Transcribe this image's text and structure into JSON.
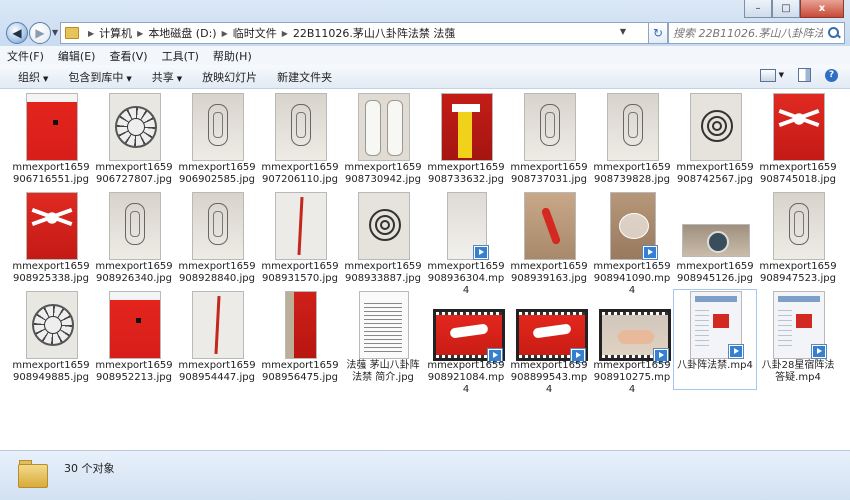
{
  "window": {
    "caption_buttons": [
      "–",
      "□",
      "x"
    ],
    "breadcrumb": [
      "计算机",
      "本地磁盘 (D:)",
      "临时文件",
      "22B11026.茅山八卦阵法禁  法蔃"
    ],
    "search_placeholder": "搜索 22B11026.茅山八卦阵法禁  法蔃"
  },
  "menu": [
    "文件(F)",
    "编辑(E)",
    "查看(V)",
    "工具(T)",
    "帮助(H)"
  ],
  "toolbar": {
    "organize": "组织",
    "include_library": "包含到库中",
    "share": "共享",
    "slideshow": "放映幻灯片",
    "new_folder": "新建文件夹"
  },
  "files": [
    {
      "name": "mmexport1659906716551.jpg",
      "kind": "red"
    },
    {
      "name": "mmexport1659906727807.jpg",
      "kind": "wheel"
    },
    {
      "name": "mmexport1659906902585.jpg",
      "kind": "sketch"
    },
    {
      "name": "mmexport1659907206110.jpg",
      "kind": "sketch"
    },
    {
      "name": "mmexport1659908730942.jpg",
      "kind": "figures"
    },
    {
      "name": "mmexport1659908733632.jpg",
      "kind": "yellow"
    },
    {
      "name": "mmexport1659908737031.jpg",
      "kind": "sketch"
    },
    {
      "name": "mmexport1659908739828.jpg",
      "kind": "sketch"
    },
    {
      "name": "mmexport1659908742567.jpg",
      "kind": "spiral"
    },
    {
      "name": "mmexport1659908745018.jpg",
      "kind": "redfig"
    },
    {
      "name": "mmexport1659908925338.jpg",
      "kind": "redfig"
    },
    {
      "name": "mmexport1659908926340.jpg",
      "kind": "sketch"
    },
    {
      "name": "mmexport1659908928840.jpg",
      "kind": "sketch"
    },
    {
      "name": "mmexport1659908931570.jpg",
      "kind": "stick"
    },
    {
      "name": "mmexport1659908933887.jpg",
      "kind": "spiral"
    },
    {
      "name": "mmexport1659908936304.mp4",
      "kind": "plainvid"
    },
    {
      "name": "mmexport1659908939163.jpg",
      "kind": "redstick"
    },
    {
      "name": "mmexport1659908941090.mp4",
      "kind": "glassvid"
    },
    {
      "name": "mmexport1659908945126.jpg",
      "kind": "glass"
    },
    {
      "name": "mmexport1659908947523.jpg",
      "kind": "sketch"
    },
    {
      "name": "mmexport1659908949885.jpg",
      "kind": "wheel"
    },
    {
      "name": "mmexport1659908952213.jpg",
      "kind": "red"
    },
    {
      "name": "mmexport1659908954447.jpg",
      "kind": "stick"
    },
    {
      "name": "mmexport1659908956475.jpg",
      "kind": "redcloth"
    },
    {
      "name": "法蔃 茅山八卦阵法禁 简介.jpg",
      "kind": "doc"
    },
    {
      "name": "mmexport1659908921084.mp4",
      "kind": "filmred"
    },
    {
      "name": "mmexport1659908899543.mp4",
      "kind": "filmred"
    },
    {
      "name": "mmexport1659908910275.mp4",
      "kind": "filmhand"
    },
    {
      "name": "八卦阵法禁.mp4",
      "kind": "screen"
    },
    {
      "name": "八卦28星宿阵法答疑.mp4",
      "kind": "screen"
    }
  ],
  "status": {
    "count_text": "30 个对象"
  }
}
